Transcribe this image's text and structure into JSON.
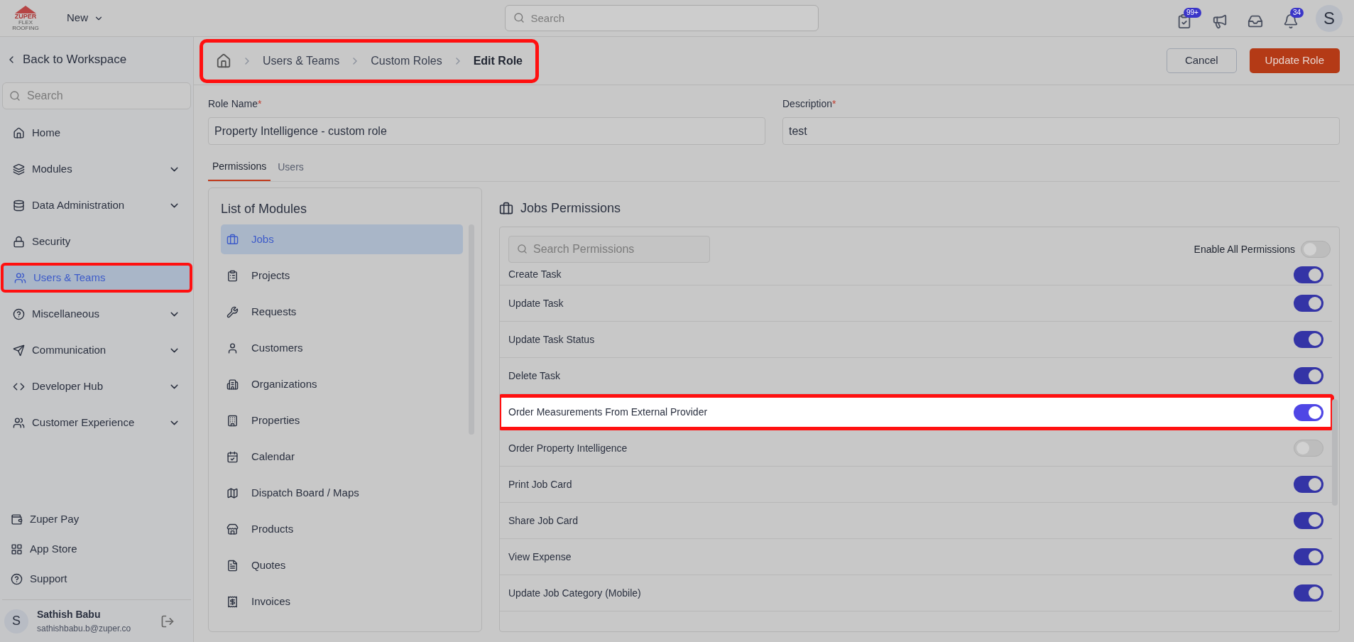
{
  "topbar": {
    "logo_lines": [
      "ZUPER",
      "FLEX",
      "ROOFING"
    ],
    "new_menu": "New",
    "search": {
      "placeholder": "Search"
    },
    "badges": [
      "99+",
      "34"
    ],
    "avatar": "S"
  },
  "sidebar": {
    "back": "Back to Workspace",
    "search": {
      "placeholder": "Search"
    },
    "items": [
      {
        "label": "Home",
        "expandable": false,
        "selected": false,
        "highlighted": false
      },
      {
        "label": "Modules",
        "expandable": true,
        "selected": false,
        "highlighted": false
      },
      {
        "label": "Data Administration",
        "expandable": true,
        "selected": false,
        "highlighted": false
      },
      {
        "label": "Security",
        "expandable": false,
        "selected": false,
        "highlighted": false
      },
      {
        "label": "Users & Teams",
        "expandable": false,
        "selected": true,
        "highlighted": true
      },
      {
        "label": "Miscellaneous",
        "expandable": true,
        "selected": false,
        "highlighted": false
      },
      {
        "label": "Communication",
        "expandable": true,
        "selected": false,
        "highlighted": false
      },
      {
        "label": "Developer Hub",
        "expandable": true,
        "selected": false,
        "highlighted": false
      },
      {
        "label": "Customer Experience",
        "expandable": true,
        "selected": false,
        "highlighted": false
      }
    ],
    "bottom_items": [
      "Zuper Pay",
      "App Store",
      "Support"
    ],
    "user": {
      "avatar": "S",
      "name": "Sathish Babu",
      "email": "sathishbabu.b@zuper.co"
    }
  },
  "breadcrumb": {
    "highlighted": true,
    "items": [
      "Users & Teams",
      "Custom Roles",
      "Edit Role"
    ]
  },
  "actions": [
    "Cancel",
    "Update Role"
  ],
  "form": [
    {
      "label": "Role Name",
      "required_mark": "*",
      "value": "Property Intelligence - custom role"
    },
    {
      "label": "Description",
      "required_mark": "*",
      "value": "test"
    }
  ],
  "tabs": [
    {
      "label": "Permissions",
      "selected": true
    },
    {
      "label": "Users",
      "selected": false
    }
  ],
  "modules": {
    "title": "List of Modules",
    "items": [
      {
        "label": "Jobs",
        "selected": true
      },
      {
        "label": "Projects",
        "selected": false
      },
      {
        "label": "Requests",
        "selected": false
      },
      {
        "label": "Customers",
        "selected": false
      },
      {
        "label": "Organizations",
        "selected": false
      },
      {
        "label": "Properties",
        "selected": false
      },
      {
        "label": "Calendar",
        "selected": false
      },
      {
        "label": "Dispatch Board / Maps",
        "selected": false
      },
      {
        "label": "Products",
        "selected": false
      },
      {
        "label": "Quotes",
        "selected": false
      },
      {
        "label": "Invoices",
        "selected": false
      }
    ]
  },
  "permissions": {
    "title": "Jobs Permissions",
    "search": {
      "placeholder": "Search Permissions"
    },
    "enable_all": {
      "label": "Enable All Permissions",
      "on": false
    },
    "items": [
      {
        "label": "Create Task",
        "on": true,
        "highlighted": false
      },
      {
        "label": "Update Task",
        "on": true,
        "highlighted": false
      },
      {
        "label": "Update Task Status",
        "on": true,
        "highlighted": false
      },
      {
        "label": "Delete Task",
        "on": true,
        "highlighted": false
      },
      {
        "label": "Order Measurements From External Provider",
        "on": true,
        "highlighted": true
      },
      {
        "label": "Order Property Intelligence",
        "on": false,
        "highlighted": false
      },
      {
        "label": "Print Job Card",
        "on": true,
        "highlighted": false
      },
      {
        "label": "Share Job Card",
        "on": true,
        "highlighted": false
      },
      {
        "label": "View Expense",
        "on": true,
        "highlighted": false
      },
      {
        "label": "Update Job Category (Mobile)",
        "on": true,
        "highlighted": false
      }
    ]
  }
}
